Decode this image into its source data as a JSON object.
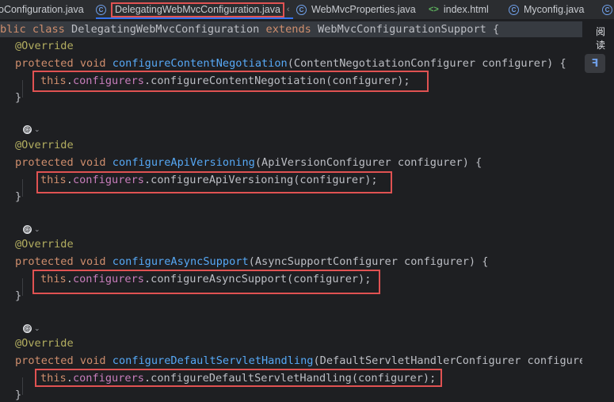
{
  "tabs": [
    {
      "label": "oConfiguration.java",
      "icon": "java-class-icon",
      "active": false
    },
    {
      "label": "DelegatingWebMvcConfiguration.java",
      "icon": "java-class-icon",
      "active": true
    },
    {
      "label": "WebMvcProperties.java",
      "icon": "java-class-icon",
      "active": false
    },
    {
      "label": "index.html",
      "icon": "html-file-icon",
      "active": false
    },
    {
      "label": "Myconfig.java",
      "icon": "java-class-icon",
      "active": false
    }
  ],
  "right_panel": {
    "reader_mode_label": "阅读"
  },
  "code": {
    "class_decl": {
      "kw1": "blic class ",
      "name": "DelegatingWebMvcConfiguration",
      "kw2": " extends ",
      "parent": "WebMvcConfigurationSupport {"
    },
    "annotation": "@Override",
    "protected_void": "protected void ",
    "this": "this",
    "configurers": "configurers",
    "close_brace": "}",
    "methods": [
      {
        "name": "configureContentNegotiation",
        "params": "(ContentNegotiationConfigurer configurer) {",
        "call": "configureContentNegotiation",
        "args": "(configurer);"
      },
      {
        "name": "configureApiVersioning",
        "params": "(ApiVersionConfigurer configurer) {",
        "call": "configureApiVersioning",
        "args": "(configurer);"
      },
      {
        "name": "configureAsyncSupport",
        "params": "(AsyncSupportConfigurer configurer) {",
        "call": "configureAsyncSupport",
        "args": "(configurer);"
      },
      {
        "name": "configureDefaultServletHandling",
        "params": "(DefaultServletHandlerConfigurer configurer) {",
        "call": "configureDefaultServletHandling",
        "args": "(configurer);"
      }
    ]
  }
}
